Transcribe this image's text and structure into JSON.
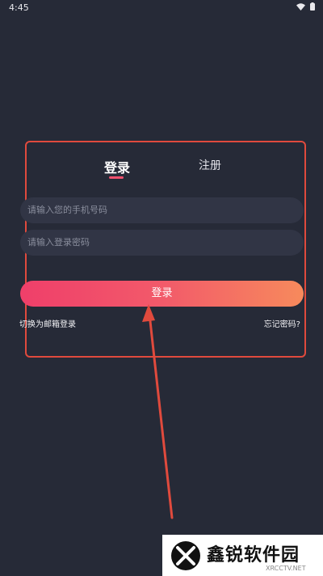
{
  "status_bar": {
    "time": "4:45"
  },
  "tabs": {
    "login": "登录",
    "register": "注册"
  },
  "form": {
    "phone_placeholder": "请输入您的手机号码",
    "password_placeholder": "请输入登录密码",
    "submit_label": "登录",
    "switch_email_link": "切换为邮箱登录",
    "forgot_password_link": "忘记密码?"
  },
  "watermark": {
    "title": "鑫锐软件园",
    "subtitle": "XRCCTV.NET"
  },
  "colors": {
    "background": "#262a37",
    "accent": "#f0506e",
    "input_bg": "#313545",
    "annotation": "#e04a3d"
  }
}
